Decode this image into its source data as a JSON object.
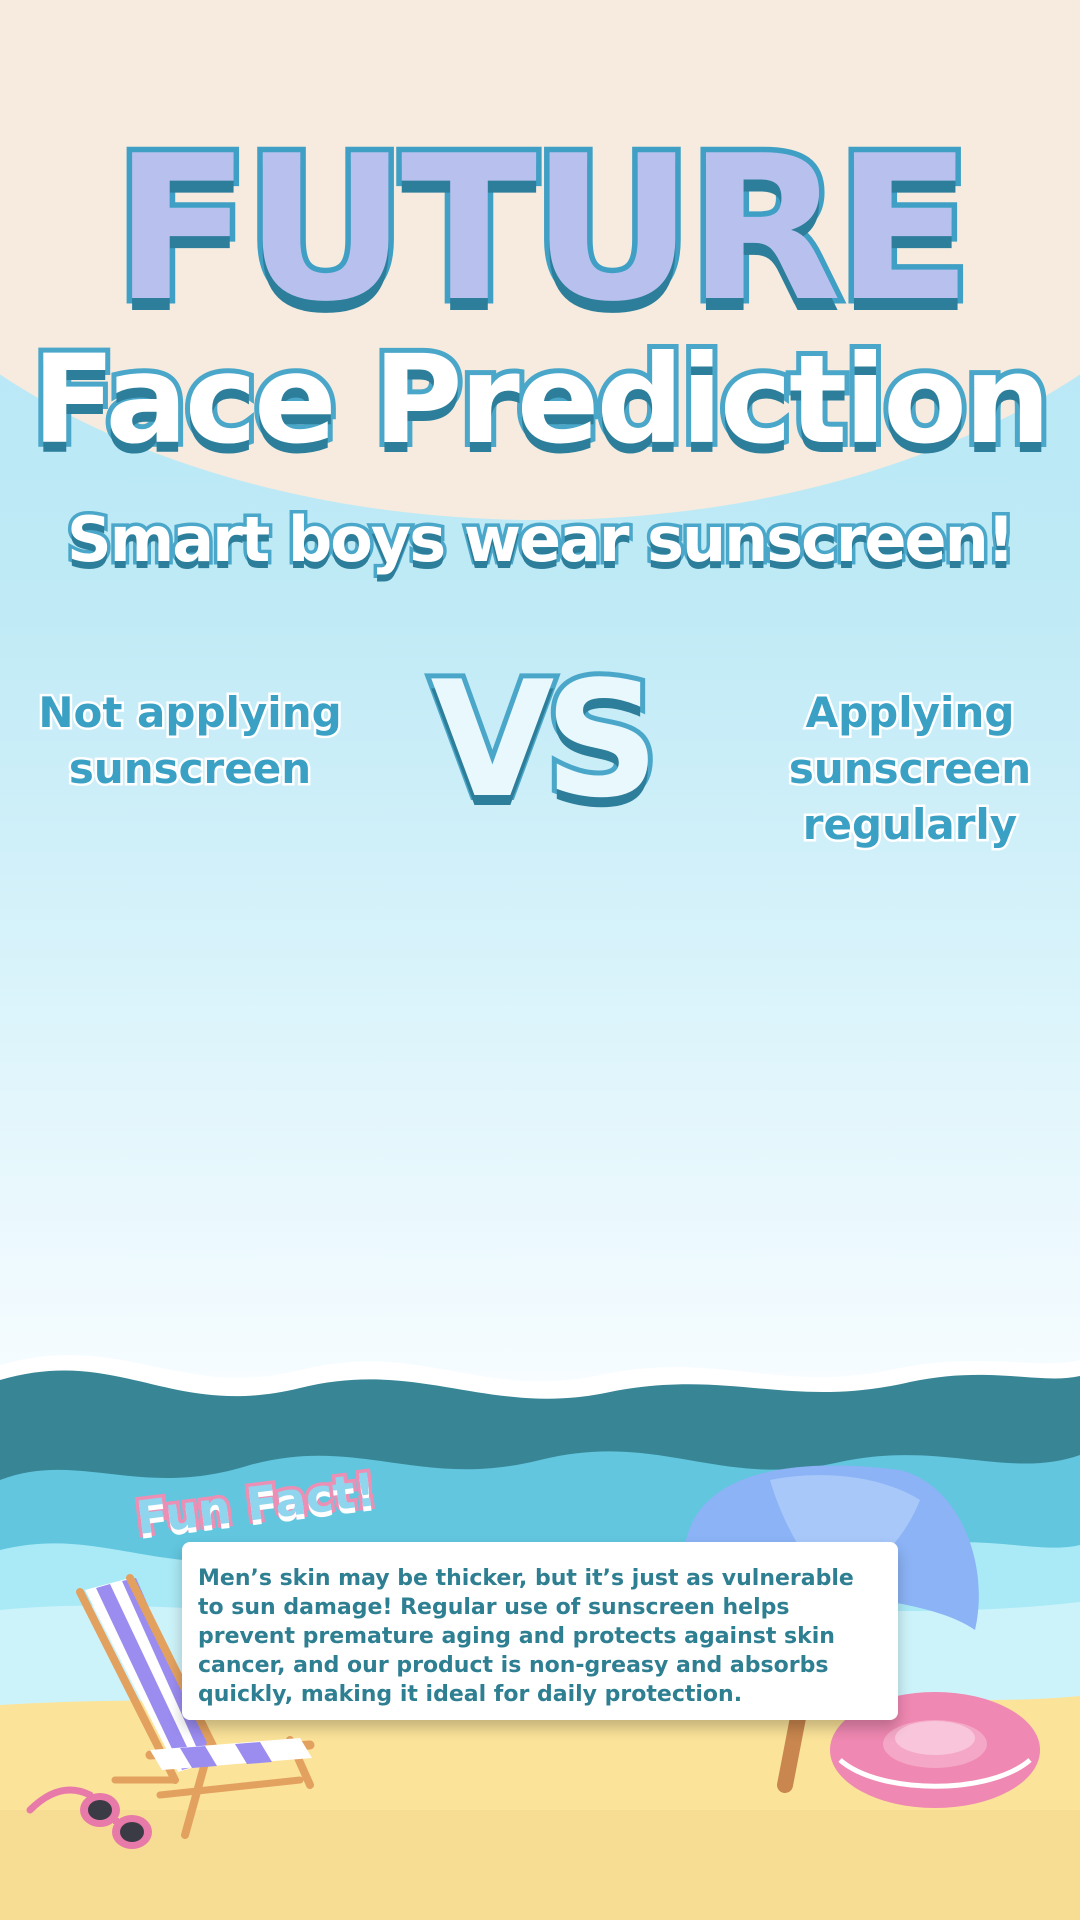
{
  "header": {
    "title_line1": "FUTURE",
    "title_line2": "Face Prediction",
    "subtitle": "Smart boys wear sunscreen!"
  },
  "comparison": {
    "left_label": "Not applying sunscreen",
    "vs_label": "VS",
    "right_label": "Applying sunscreen regularly"
  },
  "fun_fact": {
    "heading": "Fun Fact!",
    "body": "Men’s skin may be thicker, but it’s just as vulnerable to sun damage! Regular use of sunscreen helps prevent premature aging and protects against skin cancer, and our product is non-greasy and absorbs quickly, making it ideal for daily protection."
  },
  "decorations": [
    "beach-chair-icon",
    "sunglasses-icon",
    "beach-umbrella-icon",
    "swim-ring-icon"
  ],
  "colors": {
    "sky": "#bfeaf6",
    "cream": "#f6ebde",
    "outline_blue": "#4aa7c9",
    "shadow_teal": "#2d7e9a",
    "deep_wave": "#388695",
    "mid_wave": "#62c6df",
    "sand": "#fbe39a",
    "pink": "#ec8fb4"
  }
}
